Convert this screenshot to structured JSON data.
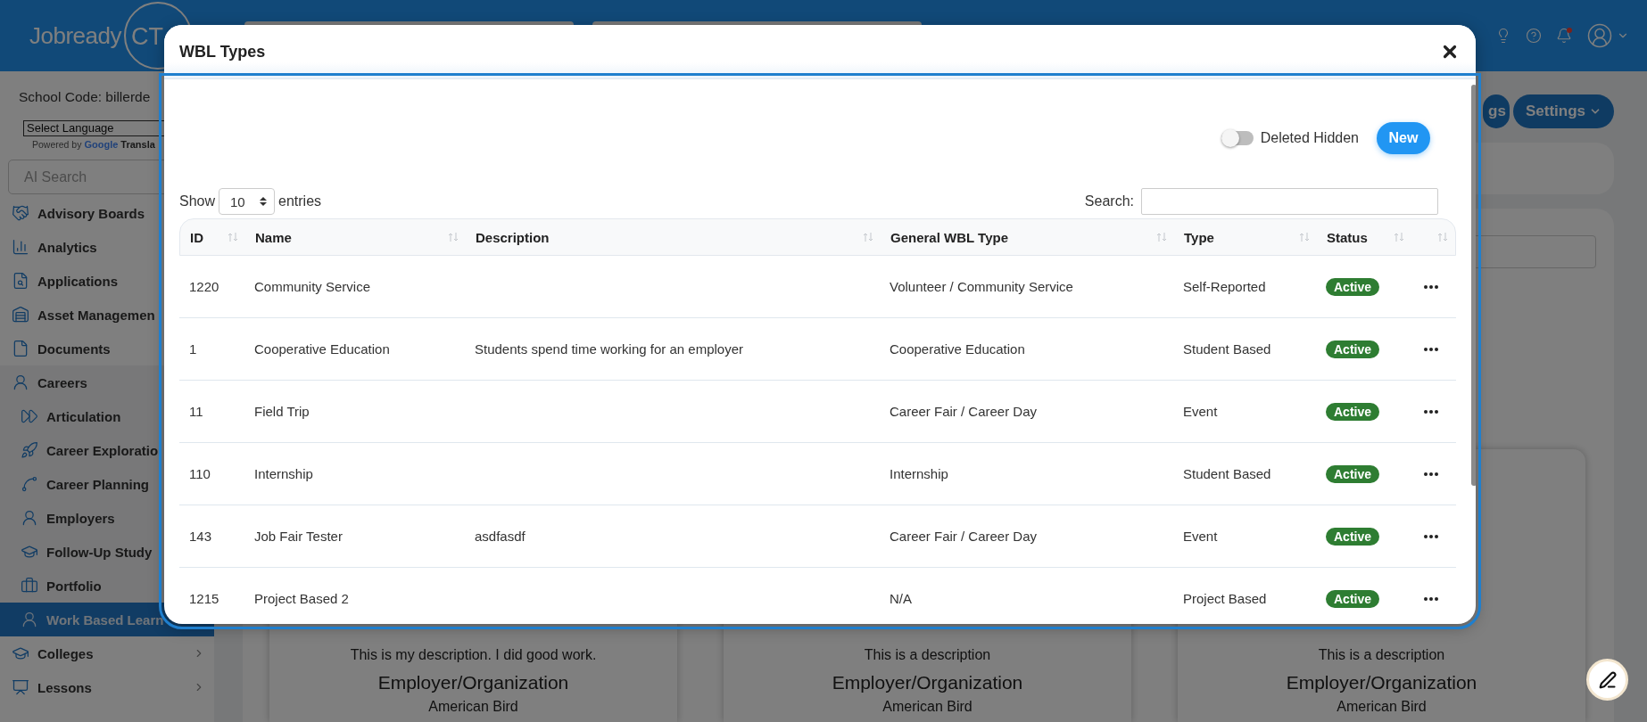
{
  "header": {
    "logo": "Jobready",
    "logo_badge": "CT"
  },
  "sidebar": {
    "school_code": "School Code: billerde",
    "language_select": "Select Language",
    "powered_by": "Powered by",
    "translate_logo": "Google",
    "translate_text": "Transla",
    "search": {
      "placeholder": "AI Search"
    },
    "items": [
      {
        "label": "Advisory Boards",
        "selected": false
      },
      {
        "label": "Analytics",
        "selected": false
      },
      {
        "label": "Applications",
        "selected": false
      },
      {
        "label": "Asset Managemen",
        "selected": false
      },
      {
        "label": "Documents",
        "selected": false
      },
      {
        "label": "Careers",
        "selected": false,
        "expanded": true,
        "children": [
          {
            "label": "Articulation",
            "selected": false
          },
          {
            "label": "Career Exploratio",
            "selected": false
          },
          {
            "label": "Career Planning",
            "selected": false
          },
          {
            "label": "Employers",
            "selected": false
          },
          {
            "label": "Follow-Up Study",
            "selected": false
          },
          {
            "label": "Portfolio",
            "selected": false
          },
          {
            "label": "Work Based Learn",
            "selected": true
          }
        ]
      },
      {
        "label": "Colleges",
        "selected": false,
        "expanded": false
      },
      {
        "label": "Lessons",
        "selected": false,
        "expanded": false
      }
    ]
  },
  "main": {
    "toolbar_buttons": [
      {
        "label": "gs",
        "dropdown": false
      },
      {
        "label": "Settings",
        "dropdown": true
      }
    ],
    "cards": [
      {
        "description": "This is my description. I did good work.",
        "employer_heading": "Employer/Organization",
        "employer": "American Bird"
      },
      {
        "description": "This is a description",
        "employer_heading": "Employer/Organization",
        "employer": "American Bird"
      },
      {
        "description": "This is a description",
        "employer_heading": "Employer/Organization",
        "employer": "American Bird"
      }
    ]
  },
  "modal": {
    "title": "WBL Types",
    "deleted_toggle": {
      "label": "Deleted Hidden",
      "on": false
    },
    "new_button": "New",
    "page_size": {
      "prefix": "Show",
      "value": "10",
      "suffix": "entries"
    },
    "search": {
      "label": "Search:"
    },
    "table": {
      "columns": [
        "ID",
        "Name",
        "Description",
        "General WBL Type",
        "Type",
        "Status"
      ],
      "rows": [
        {
          "id": "1220",
          "name": "Community Service",
          "general_type": "Volunteer / Community Service",
          "type": "Self-Reported",
          "status": "Active"
        },
        {
          "id": "1",
          "name": "Cooperative Education",
          "description": "Students spend time working for an employer",
          "general_type": "Cooperative Education",
          "type": "Student Based",
          "status": "Active"
        },
        {
          "id": "11",
          "name": "Field Trip",
          "general_type": "Career Fair / Career Day",
          "type": "Event",
          "status": "Active"
        },
        {
          "id": "110",
          "name": "Internship",
          "general_type": "Internship",
          "type": "Student Based",
          "status": "Active"
        },
        {
          "id": "143",
          "name": "Job Fair Tester",
          "description": "asdfasdf",
          "general_type": "Career Fair / Career Day",
          "type": "Event",
          "status": "Active"
        },
        {
          "id": "1215",
          "name": "Project Based 2",
          "general_type": "N/A",
          "type": "Project Based",
          "status": "Active"
        }
      ]
    }
  }
}
